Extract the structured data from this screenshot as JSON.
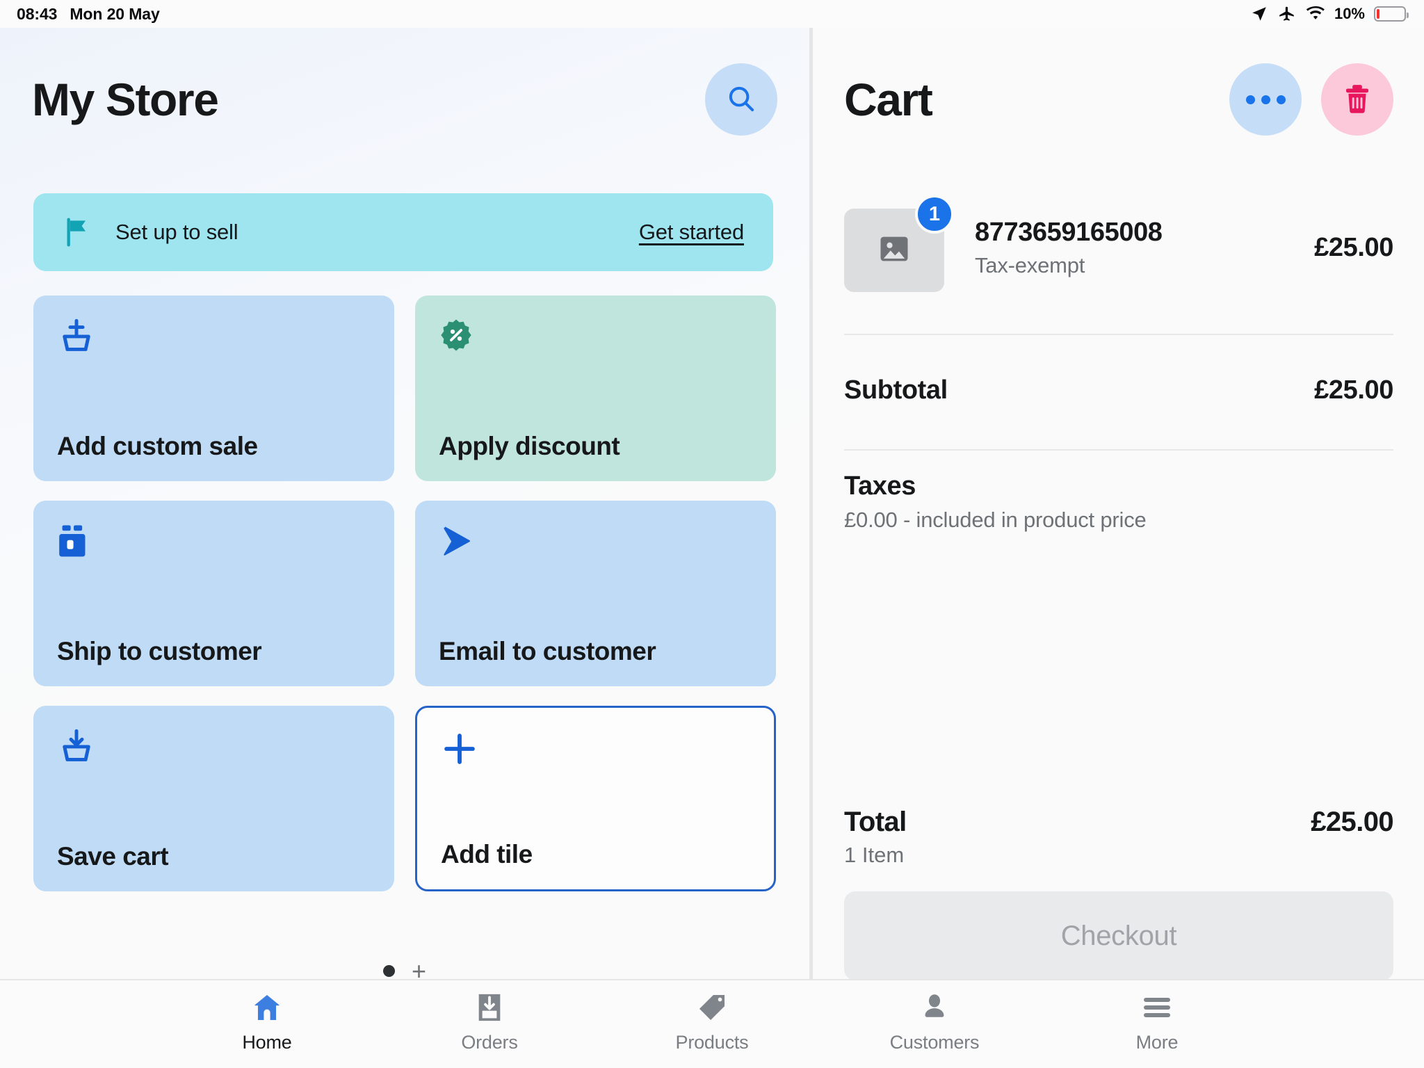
{
  "status_bar": {
    "time": "08:43",
    "date": "Mon 20 May",
    "battery_percent": "10%",
    "icons": [
      "location-arrow-icon",
      "airplane-mode-icon",
      "wifi-icon",
      "battery-icon"
    ]
  },
  "colors": {
    "accent_blue": "#1a73e8",
    "tile_blue": "#bfdbf5",
    "tile_mint": "#bfe5dd",
    "banner_cyan": "#9ee5ef",
    "danger_pink": "#fbc9d9",
    "danger_red": "#e8175d",
    "flag_teal": "#12a3b4",
    "discount_green": "#2b8f74"
  },
  "left": {
    "title": "My Store",
    "search_button": "search-icon",
    "banner": {
      "icon": "flag-icon",
      "text": "Set up to sell",
      "cta": "Get started"
    },
    "tiles": [
      {
        "label": "Add custom sale",
        "icon": "add-to-cart-icon",
        "style": "blue"
      },
      {
        "label": "Apply discount",
        "icon": "discount-percent-icon",
        "style": "mint"
      },
      {
        "label": "Ship to customer",
        "icon": "package-icon",
        "style": "blue"
      },
      {
        "label": "Email to customer",
        "icon": "send-icon",
        "style": "blue"
      },
      {
        "label": "Save cart",
        "icon": "save-cart-icon",
        "style": "blue"
      },
      {
        "label": "Add tile",
        "icon": "plus-icon",
        "style": "outline"
      }
    ],
    "pagination": {
      "current_page_dot": "•",
      "add_page": "+"
    }
  },
  "cart": {
    "title": "Cart",
    "more_button": "more-horizontal-icon",
    "delete_button": "trash-icon",
    "items": [
      {
        "name": "8773659165008",
        "subtitle": "Tax-exempt",
        "price": "£25.00",
        "quantity": "1",
        "thumbnail": "image-placeholder-icon"
      }
    ],
    "subtotal_label": "Subtotal",
    "subtotal_value": "£25.00",
    "taxes_label": "Taxes",
    "taxes_detail": "£0.00 - included in product price",
    "total_label": "Total",
    "total_items": "1 Item",
    "total_value": "£25.00",
    "checkout_label": "Checkout"
  },
  "tabbar": {
    "tabs": [
      {
        "label": "Home",
        "icon": "home-icon",
        "active": true
      },
      {
        "label": "Orders",
        "icon": "orders-icon",
        "active": false
      },
      {
        "label": "Products",
        "icon": "tag-icon",
        "active": false
      },
      {
        "label": "Customers",
        "icon": "person-icon",
        "active": false
      },
      {
        "label": "More",
        "icon": "hamburger-menu-icon",
        "active": false
      }
    ]
  }
}
